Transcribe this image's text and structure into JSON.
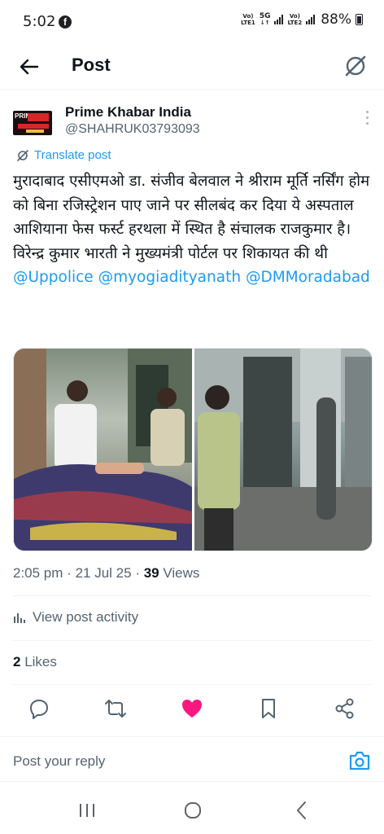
{
  "status_bar": {
    "time": "5:02",
    "notification_icon": "facebook-icon",
    "sim1": {
      "volte": "Vo)",
      "lte": "LTE1",
      "network": "5G"
    },
    "sim2": {
      "volte": "Vo)",
      "lte": "LTE2"
    },
    "battery": "88%"
  },
  "header": {
    "title": "Post",
    "back_icon": "arrow-left-icon",
    "grok_icon": "grok-icon"
  },
  "author": {
    "name": "Prime Khabar India",
    "handle": "@SHAHRUK03793093",
    "avatar_text": "PRIME"
  },
  "translate": {
    "label": "Translate post",
    "icon": "grok-icon"
  },
  "post": {
    "text": "मुरादाबाद एसीएमओ डा. संजीव बेलवाल ने श्रीराम मूर्ति नर्सिंग होम को बिना रजिस्ट्रेशन पाए जाने पर सीलबंद कर दिया ये अस्पताल आशियाना फेस फर्स्ट हरथला में स्थित है संचालक राजकुमार है। विरेन्द्र कुमार भारती ने मुख्यमंत्री पोर्टल पर शिकायत की थी",
    "mentions": [
      "@Uppolice",
      "@myogiadityanath",
      "@DMMoradabad"
    ]
  },
  "meta": {
    "time": "2:05 pm",
    "separator": "·",
    "date": "21 Jul 25",
    "views_count": "39",
    "views_label": "Views"
  },
  "activity": {
    "label": "View post activity",
    "icon": "bar-chart-icon"
  },
  "likes": {
    "count": "2",
    "label": "Likes"
  },
  "actions": [
    "reply-icon",
    "repost-icon",
    "like-icon",
    "bookmark-icon",
    "share-icon"
  ],
  "colors": {
    "accent": "#1d9bf0",
    "like": "#f91880",
    "text": "#0f1419",
    "muted": "#536471"
  },
  "reply": {
    "placeholder": "Post your reply",
    "icon": "camera-icon"
  },
  "nav": [
    "recents-icon",
    "home-icon",
    "back-icon"
  ]
}
